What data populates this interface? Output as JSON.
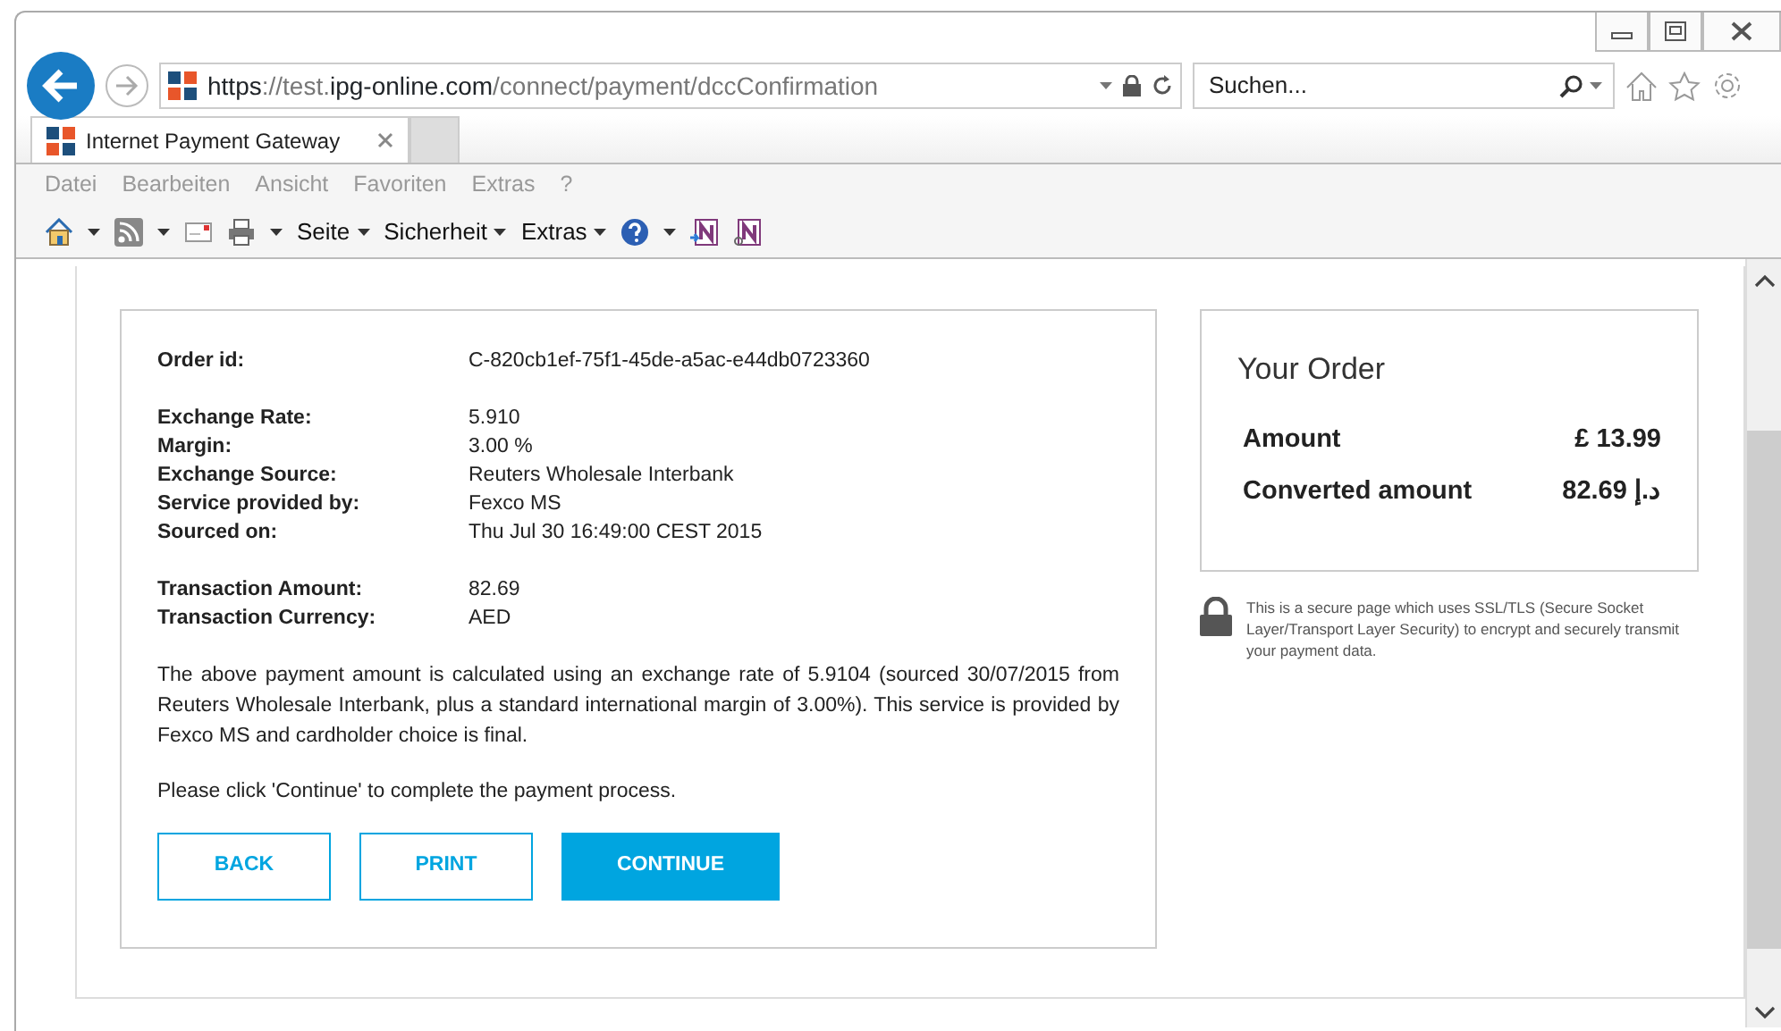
{
  "browser": {
    "url": {
      "scheme": "https",
      "host_prefix": "://test.",
      "domain": "ipg-online.com",
      "path": "/connect/payment/dccConfirmation"
    },
    "search": {
      "placeholder": "Suchen..."
    },
    "tabs": [
      {
        "label": "Internet Payment Gateway",
        "selected": true
      }
    ],
    "menu": [
      "Datei",
      "Bearbeiten",
      "Ansicht",
      "Favoriten",
      "Extras",
      "?"
    ],
    "toolbar": [
      {
        "kind": "home"
      },
      {
        "kind": "feeds"
      },
      {
        "kind": "mail"
      },
      {
        "kind": "print"
      },
      {
        "kind": "menu",
        "label": "Seite"
      },
      {
        "kind": "menu",
        "label": "Sicherheit"
      },
      {
        "kind": "menu",
        "label": "Extras"
      },
      {
        "kind": "help"
      },
      {
        "kind": "onenote"
      },
      {
        "kind": "onenote-link"
      }
    ]
  },
  "details": {
    "groups": [
      [
        {
          "label": "Order id:",
          "value": "C-820cb1ef-75f1-45de-a5ac-e44db0723360"
        }
      ],
      [
        {
          "label": "Exchange Rate:",
          "value": "5.910"
        },
        {
          "label": "Margin:",
          "value": "3.00 %"
        },
        {
          "label": "Exchange Source:",
          "value": "Reuters Wholesale Interbank"
        },
        {
          "label": "Service provided by:",
          "value": "Fexco MS"
        },
        {
          "label": "Sourced on:",
          "value": "Thu Jul 30 16:49:00 CEST 2015"
        }
      ],
      [
        {
          "label": "Transaction Amount:",
          "value": "82.69"
        },
        {
          "label": "Transaction Currency:",
          "value": "AED"
        }
      ]
    ],
    "disclaimer": "The above payment amount is calculated using an exchange rate of 5.9104 (sourced 30/07/2015 from Reuters Wholesale Interbank, plus a standard international margin of 3.00%). This service is provided by Fexco MS and cardholder choice is final.",
    "instruction": "Please click 'Continue' to complete the payment process.",
    "buttons": [
      {
        "label": "BACK",
        "kind": "outline"
      },
      {
        "label": "PRINT",
        "kind": "outline"
      },
      {
        "label": "CONTINUE",
        "kind": "primary"
      }
    ]
  },
  "order": {
    "title": "Your Order",
    "rows": [
      {
        "label": "Amount",
        "value": "£ 13.99"
      },
      {
        "label": "Converted amount",
        "value": "82.69 د.إ"
      }
    ]
  },
  "secure_note": "This is a secure page which uses SSL/TLS (Secure Socket Layer/Transport Layer Security) to encrypt and securely transmit your payment data."
}
